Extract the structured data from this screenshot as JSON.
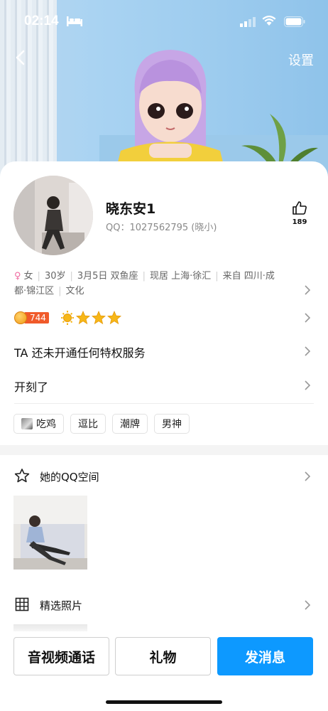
{
  "status_bar": {
    "time": "02:14",
    "icons": [
      "bed-icon",
      "signal-icon",
      "wifi-icon",
      "battery-icon"
    ]
  },
  "header": {
    "back_icon": "chevron-left-icon",
    "settings_label": "设置"
  },
  "profile": {
    "nickname": "晓东安1",
    "qq_line": "QQ：1027562795 (晓小)",
    "like_count": "189",
    "info": {
      "gender": "女",
      "age": "30岁",
      "birthday": "3月5日 双鱼座",
      "location": "现居 上海·徐汇",
      "hometown_line1": "来自 四川·成",
      "hometown_line2": "都·锦江区",
      "profession": "文化"
    },
    "level_number": "744",
    "privilege_text": "TA 还未开通任何特权服务",
    "signature": "开刻了",
    "tags": [
      "吃鸡",
      "逗比",
      "潮牌",
      "男神"
    ]
  },
  "sections": {
    "qzone_title": "她的QQ空间",
    "photos_title": "精选照片"
  },
  "actions": {
    "call_label": "音视频通话",
    "gift_label": "礼物",
    "message_label": "发消息"
  },
  "colors": {
    "accent": "#0d99ff",
    "level_badge": "#f05a2a",
    "female": "#ef6aa0",
    "star": "#f7b718"
  }
}
